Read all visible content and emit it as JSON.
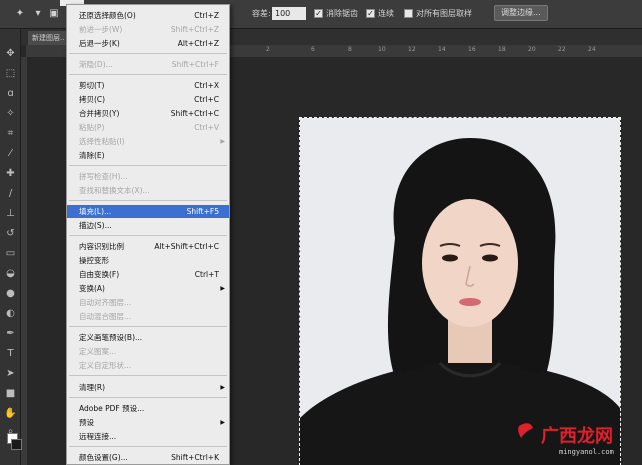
{
  "options_bar": {
    "opacity_label": "容差:",
    "opacity_value": "100",
    "anti_alias_label": "消除锯齿",
    "contiguous_label": "连续",
    "sample_all_label": "对所有图层取样",
    "refine_edge_label": "调整边缘..."
  },
  "document_tab": {
    "label": "新建图层.."
  },
  "ruler_ticks": [
    "2",
    "6",
    "8",
    "10",
    "12",
    "14",
    "16",
    "18",
    "20",
    "22",
    "24"
  ],
  "edit_menu": {
    "items": [
      {
        "label": "还原选择颜色(O)",
        "shortcut": "Ctrl+Z",
        "disabled": false
      },
      {
        "label": "前进一步(W)",
        "shortcut": "Shift+Ctrl+Z",
        "disabled": true
      },
      {
        "label": "后退一步(K)",
        "shortcut": "Alt+Ctrl+Z",
        "disabled": false
      },
      {
        "label": "渐隐(D)...",
        "shortcut": "Shift+Ctrl+F",
        "disabled": true
      },
      {
        "label": "剪切(T)",
        "shortcut": "Ctrl+X",
        "disabled": false
      },
      {
        "label": "拷贝(C)",
        "shortcut": "Ctrl+C",
        "disabled": false
      },
      {
        "label": "合并拷贝(Y)",
        "shortcut": "Shift+Ctrl+C",
        "disabled": false
      },
      {
        "label": "粘贴(P)",
        "shortcut": "Ctrl+V",
        "disabled": true
      },
      {
        "label": "选择性粘贴(I)",
        "shortcut": "",
        "disabled": true,
        "submenu": true
      },
      {
        "label": "清除(E)",
        "shortcut": "",
        "disabled": false
      },
      {
        "label": "拼写检查(H)...",
        "shortcut": "",
        "disabled": true
      },
      {
        "label": "查找和替换文本(X)...",
        "shortcut": "",
        "disabled": true
      },
      {
        "label": "填充(L)...",
        "shortcut": "Shift+F5",
        "disabled": false,
        "highlighted": true
      },
      {
        "label": "描边(S)...",
        "shortcut": "",
        "disabled": false
      },
      {
        "label": "内容识别比例",
        "shortcut": "Alt+Shift+Ctrl+C",
        "disabled": false
      },
      {
        "label": "操控变形",
        "shortcut": "",
        "disabled": false
      },
      {
        "label": "自由变换(F)",
        "shortcut": "Ctrl+T",
        "disabled": false
      },
      {
        "label": "变换(A)",
        "shortcut": "",
        "disabled": false,
        "submenu": true
      },
      {
        "label": "自动对齐图层...",
        "shortcut": "",
        "disabled": true
      },
      {
        "label": "自动混合图层...",
        "shortcut": "",
        "disabled": true
      },
      {
        "label": "定义画笔预设(B)...",
        "shortcut": "",
        "disabled": false
      },
      {
        "label": "定义图案...",
        "shortcut": "",
        "disabled": true
      },
      {
        "label": "定义自定形状...",
        "shortcut": "",
        "disabled": true
      },
      {
        "label": "清理(R)",
        "shortcut": "",
        "disabled": false,
        "submenu": true
      },
      {
        "label": "Adobe PDF 预设...",
        "shortcut": "",
        "disabled": false
      },
      {
        "label": "预设",
        "shortcut": "",
        "disabled": false,
        "submenu": true
      },
      {
        "label": "远程连接...",
        "shortcut": "",
        "disabled": false
      },
      {
        "label": "颜色设置(G)...",
        "shortcut": "Shift+Ctrl+K",
        "disabled": false
      }
    ]
  },
  "watermark": {
    "brand": "广西龙网",
    "domain": "mingyanol.com"
  },
  "colors": {
    "highlight": "#3b6fd1",
    "watermark": "#e0202a"
  }
}
